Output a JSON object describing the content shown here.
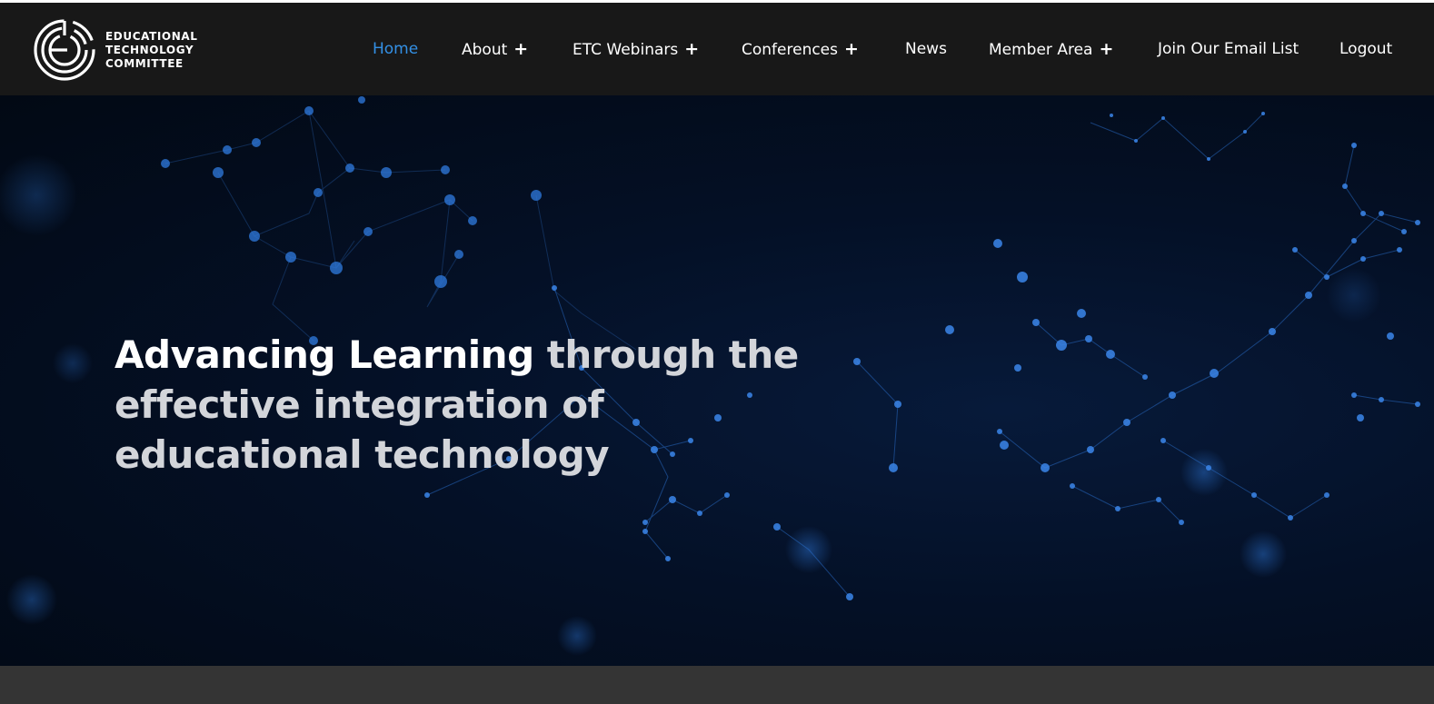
{
  "logo": {
    "line1": "EDUCATIONAL",
    "line2": "TECHNOLOGY",
    "line3": "COMMITTEE"
  },
  "nav": {
    "items": [
      {
        "label": "Home",
        "has_plus": false
      },
      {
        "label": "About",
        "has_plus": true
      },
      {
        "label": "ETC Webinars",
        "has_plus": true
      },
      {
        "label": "Conferences",
        "has_plus": true
      },
      {
        "label": "News",
        "has_plus": false
      },
      {
        "label": "Member Area",
        "has_plus": true
      },
      {
        "label": "Join Our Email List",
        "has_plus": false
      },
      {
        "label": "Logout",
        "has_plus": false
      }
    ],
    "plus_symbol": "+",
    "active_color": "#3390e5",
    "text_color": "#ffffff"
  },
  "hero": {
    "headline_strong": "Advancing Learning",
    "headline_rest": "through the effective integration of educational technology",
    "background": "network-particles"
  },
  "colors": {
    "header_bg": "#181818",
    "hero_bg": "#041026",
    "node": "#2f7be0",
    "footer_band": "#343434"
  }
}
